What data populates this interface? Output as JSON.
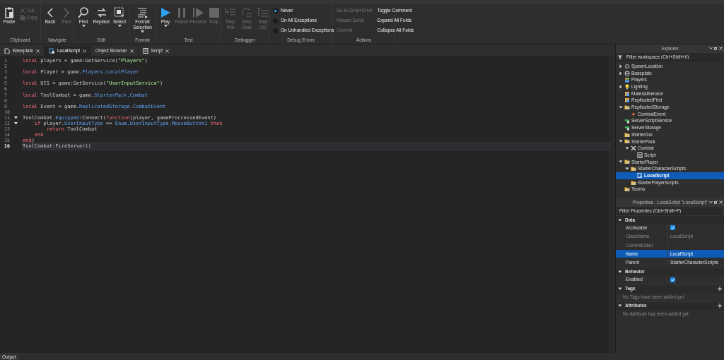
{
  "ribbon": [
    {
      "label": "Clipboard",
      "items": [
        {
          "kind": "big",
          "label": "Paste",
          "disabled": false
        },
        {
          "kind": "small",
          "label": "Cut",
          "disabled": true
        },
        {
          "kind": "small",
          "label": "Copy",
          "disabled": true
        }
      ]
    },
    {
      "label": "Navigate",
      "items": [
        {
          "kind": "big",
          "label": "Back",
          "disabled": false
        },
        {
          "kind": "big",
          "label": "Fwd",
          "disabled": true
        }
      ]
    },
    {
      "label": "Edit",
      "items": [
        {
          "kind": "big",
          "label": "Find",
          "disabled": false,
          "caret": true
        },
        {
          "kind": "big",
          "label": "Replace",
          "disabled": false
        },
        {
          "kind": "big",
          "label": "Select",
          "disabled": false,
          "caret": true
        }
      ]
    },
    {
      "label": "Format",
      "items": [
        {
          "kind": "big",
          "label": "Format Selection",
          "disabled": false,
          "caret": true
        }
      ]
    },
    {
      "label": "Test",
      "items": [
        {
          "kind": "big",
          "label": "Play",
          "disabled": false,
          "caret": true
        },
        {
          "kind": "big",
          "label": "Pause",
          "disabled": true
        },
        {
          "kind": "big",
          "label": "Resume",
          "disabled": true
        },
        {
          "kind": "big",
          "label": "Stop",
          "disabled": true
        }
      ]
    },
    {
      "label": "Debugger",
      "items": [
        {
          "kind": "big",
          "label": "Step Into",
          "disabled": true
        },
        {
          "kind": "big",
          "label": "Step Over",
          "disabled": true
        },
        {
          "kind": "big",
          "label": "Step Out",
          "disabled": true
        }
      ]
    },
    {
      "label": "Debug Errors",
      "items": [
        {
          "kind": "radio",
          "label": "Never",
          "selected": true
        },
        {
          "kind": "radio",
          "label": "On All Exceptions",
          "selected": false
        },
        {
          "kind": "radio",
          "label": "On Unhandled Exceptions",
          "selected": false
        }
      ]
    },
    {
      "label": "Actions",
      "items": [
        {
          "kind": "text",
          "label": "Go to Script Error",
          "disabled": true
        },
        {
          "kind": "text",
          "label": "Reload Script",
          "disabled": true
        },
        {
          "kind": "text",
          "label": "Commit",
          "disabled": true
        },
        {
          "kind": "text",
          "label": "Toggle Comment",
          "disabled": false
        },
        {
          "kind": "text",
          "label": "Expand All Folds",
          "disabled": false
        },
        {
          "kind": "text",
          "label": "Collapse All Folds",
          "disabled": false
        }
      ]
    }
  ],
  "doc_tabs": [
    {
      "label": "Baseplate",
      "kind": "place",
      "selected": false
    },
    {
      "label": "LocalScript",
      "kind": "localscript",
      "selected": true
    },
    {
      "label": "Object Browser",
      "selected": false
    },
    {
      "label": "Script",
      "kind": "script",
      "selected": false
    }
  ],
  "editor": {
    "lines": [
      {
        "number": "1",
        "fold": false,
        "current": false,
        "tokens": [
          {
            "text": "local",
            "kind": "kw"
          },
          {
            "text": " players = game:GetService(",
            "kind": "plain"
          },
          {
            "text": "\"Players\"",
            "kind": "str"
          },
          {
            "text": ")",
            "kind": "plain"
          }
        ]
      },
      {
        "number": "2",
        "fold": false,
        "current": false
      },
      {
        "number": "3",
        "fold": false,
        "current": false,
        "tokens": [
          {
            "text": "local",
            "kind": "kw"
          },
          {
            "text": " Player = game.",
            "kind": "plain"
          },
          {
            "text": "Players",
            "kind": "prop"
          },
          {
            "text": ".",
            "kind": "plain"
          },
          {
            "text": "LocalPlayer",
            "kind": "prop"
          }
        ]
      },
      {
        "number": "4",
        "fold": false,
        "current": false
      },
      {
        "number": "5",
        "fold": false,
        "current": false,
        "tokens": [
          {
            "text": "local",
            "kind": "kw"
          },
          {
            "text": " UIS = game:GetService(",
            "kind": "plain"
          },
          {
            "text": "\"UserInputService\"",
            "kind": "str"
          },
          {
            "text": ")",
            "kind": "plain"
          }
        ]
      },
      {
        "number": "6",
        "fold": false,
        "current": false
      },
      {
        "number": "7",
        "fold": false,
        "current": false,
        "tokens": [
          {
            "text": "local",
            "kind": "kw"
          },
          {
            "text": " ToolCombat = game.",
            "kind": "plain"
          },
          {
            "text": "StarterPack",
            "kind": "prop"
          },
          {
            "text": ".",
            "kind": "plain"
          },
          {
            "text": "Combat",
            "kind": "prop"
          }
        ]
      },
      {
        "number": "8",
        "fold": false,
        "current": false
      },
      {
        "number": "9",
        "fold": false,
        "current": false,
        "tokens": [
          {
            "text": "local",
            "kind": "kw"
          },
          {
            "text": " Event = game.",
            "kind": "plain"
          },
          {
            "text": "ReplicatedStorage",
            "kind": "prop"
          },
          {
            "text": ".",
            "kind": "plain"
          },
          {
            "text": "CombatEvent",
            "kind": "prop"
          }
        ]
      },
      {
        "number": "10",
        "fold": false,
        "current": false
      },
      {
        "number": "11",
        "fold": true,
        "current": false,
        "tokens": [
          {
            "text": "ToolCombat.",
            "kind": "plain"
          },
          {
            "text": "Equipped",
            "kind": "prop"
          },
          {
            "text": ":Connect(",
            "kind": "plain"
          },
          {
            "text": "function",
            "kind": "kw"
          },
          {
            "text": "(player, gameProccessedEvent)",
            "kind": "plain"
          }
        ]
      },
      {
        "number": "12",
        "fold": true,
        "current": false,
        "tokens": [
          {
            "text": "    if",
            "kind": "kw"
          },
          {
            "text": " player.",
            "kind": "plain"
          },
          {
            "text": "UserInputType",
            "kind": "prop"
          },
          {
            "text": " == ",
            "kind": "plain"
          },
          {
            "text": "Enum.UserInputType.MouseButton1",
            "kind": "prop"
          },
          {
            "text": " then",
            "kind": "kw"
          }
        ]
      },
      {
        "number": "13",
        "fold": false,
        "current": false,
        "tokens": [
          {
            "text": "        return",
            "kind": "kw"
          },
          {
            "text": " ToolCombat",
            "kind": "plain"
          }
        ]
      },
      {
        "number": "14",
        "fold": false,
        "current": false,
        "tokens": [
          {
            "text": "    end",
            "kind": "kw"
          }
        ]
      },
      {
        "number": "15",
        "fold": false,
        "current": false,
        "tokens": [
          {
            "text": "end",
            "kind": "kw"
          },
          {
            "text": ")",
            "kind": "plain"
          }
        ]
      },
      {
        "number": "16",
        "fold": false,
        "current": true,
        "tokens": [
          {
            "text": "ToolCombat:FireServer()",
            "kind": "plain"
          }
        ]
      }
    ]
  },
  "explorer": {
    "title": "Explorer",
    "filter": {
      "placeholder": "Filter workspace (Ctrl+Shift+X)"
    },
    "items": [
      {
        "label": "SpawnLocation",
        "kind": "spawn",
        "expanded": false,
        "selected": false
      },
      {
        "label": "Baseplate",
        "kind": "part",
        "expanded": false,
        "selected": false
      },
      {
        "label": "Players",
        "kind": "players",
        "selected": false
      },
      {
        "label": "Lighting",
        "kind": "light",
        "expanded": false,
        "selected": false
      },
      {
        "label": "MaterialService",
        "kind": "service",
        "selected": false
      },
      {
        "label": "ReplicatedFirst",
        "kind": "service",
        "selected": false
      },
      {
        "label": "ReplicatedStorage",
        "kind": "folder",
        "expanded": true,
        "selected": false,
        "children": [
          {
            "label": "CombatEvent",
            "kind": "event",
            "selected": false
          }
        ]
      },
      {
        "label": "ServerScriptService",
        "kind": "server",
        "selected": false
      },
      {
        "label": "ServerStorage",
        "kind": "server",
        "selected": false
      },
      {
        "label": "StarterGui",
        "kind": "folder",
        "selected": false
      },
      {
        "label": "StarterPack",
        "kind": "folder",
        "expanded": true,
        "selected": false,
        "children": [
          {
            "label": "Combat",
            "kind": "tool",
            "expanded": true,
            "selected": false,
            "children": [
              {
                "label": "Script",
                "kind": "script",
                "selected": false
              }
            ]
          }
        ]
      },
      {
        "label": "StarterPlayer",
        "kind": "folder",
        "expanded": true,
        "selected": false,
        "children": [
          {
            "label": "StarterCharacterScripts",
            "kind": "folder",
            "expanded": true,
            "selected": false,
            "children": [
              {
                "label": "LocalScript",
                "kind": "localscript",
                "selected": true
              }
            ]
          },
          {
            "label": "StarterPlayerScripts",
            "kind": "folder",
            "selected": false
          }
        ]
      },
      {
        "label": "Teams",
        "kind": "folder",
        "selected": false
      }
    ]
  },
  "properties": {
    "title": "Properties - LocalScript \"LocalScript\"",
    "filter": {
      "placeholder": "Filter Properties (Ctrl+Shift+P)"
    },
    "sections": [
      {
        "label": "Data",
        "expanded": true,
        "rows": [
          {
            "name": "Archivable",
            "kind": "checkbox",
            "checked": true,
            "disabled": false,
            "selected": false
          },
          {
            "name": "ClassName",
            "kind": "text",
            "value": "LocalScript",
            "disabled": true,
            "selected": false
          },
          {
            "name": "CurrentEditor",
            "kind": "text",
            "disabled": true,
            "selected": false
          },
          {
            "name": "Name",
            "kind": "text",
            "value": "LocalScript",
            "disabled": false,
            "selected": true
          },
          {
            "name": "Parent",
            "kind": "text",
            "value": "StarterCharacterScripts",
            "disabled": false,
            "selected": false
          }
        ]
      },
      {
        "label": "Behavior",
        "expanded": true,
        "rows": [
          {
            "name": "Enabled",
            "kind": "checkbox",
            "checked": true,
            "disabled": false,
            "selected": false
          }
        ]
      },
      {
        "label": "Tags",
        "expanded": true,
        "addable": true,
        "message": "No Tags have been added yet"
      },
      {
        "label": "Attributes",
        "expanded": true,
        "addable": true,
        "message": "No Attribute has been added yet"
      }
    ]
  },
  "bottom_tab": {
    "label": "Output"
  }
}
